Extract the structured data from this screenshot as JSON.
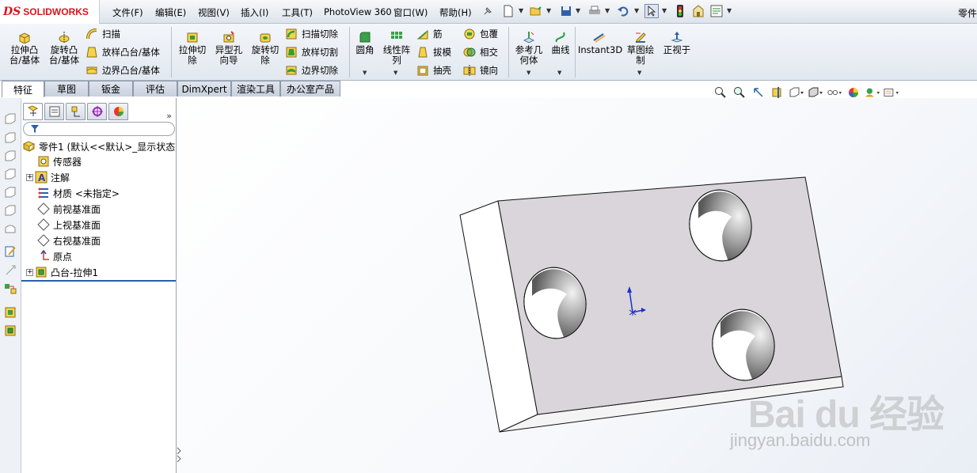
{
  "app": {
    "brand_ds": "DS",
    "brand_name": "SOLIDWORKS",
    "doc_title": "零件"
  },
  "menu": [
    "文件(F)",
    "编辑(E)",
    "视图(V)",
    "插入(I)",
    "工具(T)",
    "PhotoView 360",
    "窗口(W)",
    "帮助(H)"
  ],
  "quick_access": [
    "pin-icon",
    "new-file-icon",
    "open-icon",
    "save-icon",
    "print-icon",
    "undo-icon",
    "select-icon",
    "rebuild-icon",
    "options-icon",
    "file-props-icon"
  ],
  "command_manager": {
    "extrude_boss": "拉伸凸\n台/基体",
    "revolve_boss": "旋转凸\n台/基体",
    "sweep": "扫描",
    "loft_boss": "放样凸台/基体",
    "boundary_boss": "边界凸台/基体",
    "extrude_cut": "拉伸切\n除",
    "hole_wizard": "异型孔\n向导",
    "revolve_cut": "旋转切\n除",
    "sweep_cut": "扫描切除",
    "loft_cut": "放样切割",
    "boundary_cut": "边界切除",
    "fillet": "圆角",
    "linear_pattern": "线性阵\n列",
    "rib": "筋",
    "draft": "拔模",
    "shell": "抽壳",
    "wrap": "包覆",
    "intersect": "相交",
    "mirror": "镜向",
    "ref_geometry": "参考几\n何体",
    "curves": "曲线",
    "instant3d": "Instant3D",
    "sketch_draw": "草图绘\n制",
    "normal_to": "正视于"
  },
  "tabs": [
    {
      "label": "特征",
      "active": true
    },
    {
      "label": "草图",
      "active": false
    },
    {
      "label": "钣金",
      "active": false
    },
    {
      "label": "评估",
      "active": false
    },
    {
      "label": "DimXpert",
      "active": false
    },
    {
      "label": "渲染工具",
      "active": false
    },
    {
      "label": "办公室产品",
      "active": false
    }
  ],
  "feature_tree": {
    "part": "零件1 (默认<<默认>_显示状态",
    "items": [
      {
        "label": "传感器",
        "icon": "sensor-icon",
        "expandable": false
      },
      {
        "label": "注解",
        "icon": "annotation-icon",
        "expandable": true
      },
      {
        "label": "材质 <未指定>",
        "icon": "material-icon",
        "expandable": false
      },
      {
        "label": "前视基准面",
        "icon": "plane-icon",
        "expandable": false
      },
      {
        "label": "上视基准面",
        "icon": "plane-icon",
        "expandable": false
      },
      {
        "label": "右视基准面",
        "icon": "plane-icon",
        "expandable": false
      },
      {
        "label": "原点",
        "icon": "origin-icon",
        "expandable": false
      },
      {
        "label": "凸台-拉伸1",
        "icon": "extrude-feature-icon",
        "expandable": true
      }
    ]
  },
  "colors": {
    "part_face": "#d9d5da",
    "part_side": "#ffffff",
    "accent": "#2b5ea8",
    "brand": "#d9141a"
  },
  "watermark": {
    "logo": "Bai du 经验",
    "url": "jingyan.baidu.com"
  }
}
